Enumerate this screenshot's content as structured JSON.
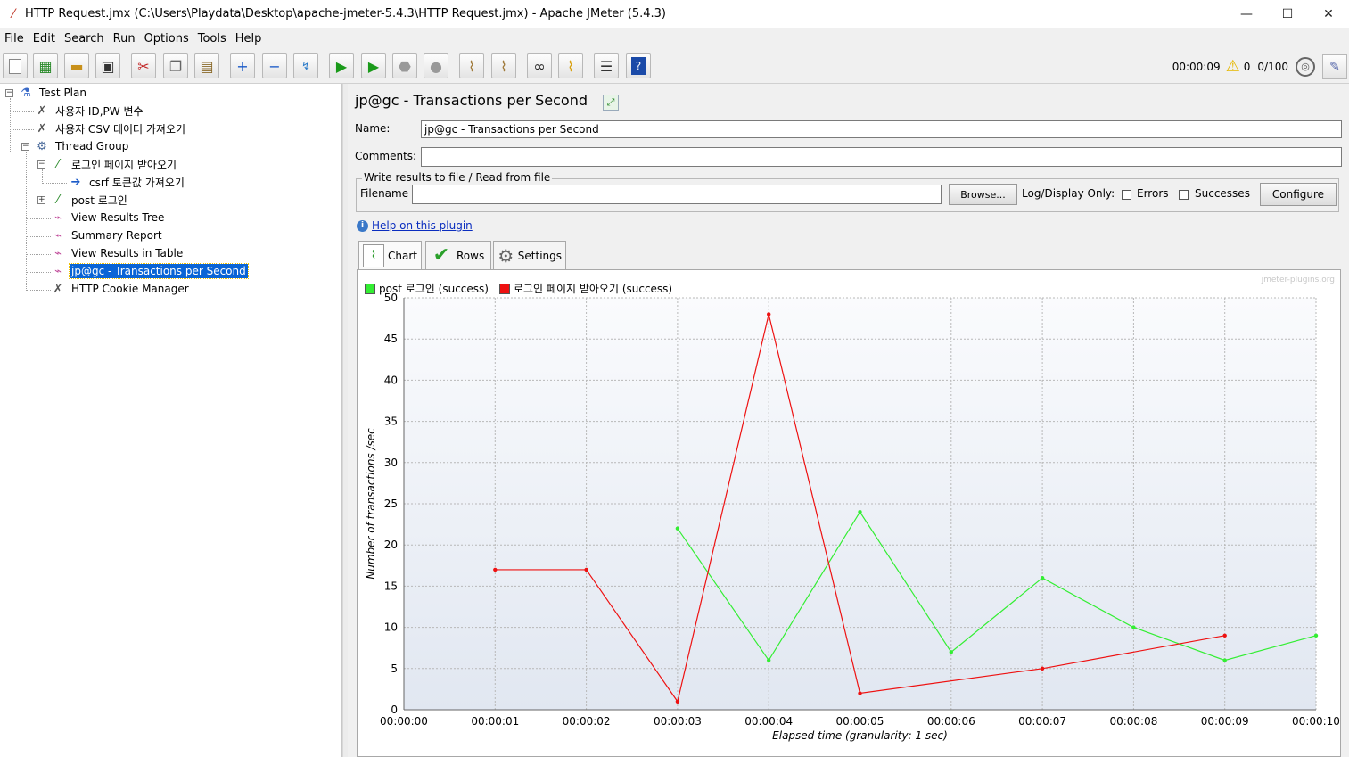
{
  "window": {
    "title": "HTTP Request.jmx (C:\\Users\\Playdata\\Desktop\\apache-jmeter-5.4.3\\HTTP Request.jmx) - Apache JMeter (5.4.3)",
    "minimize": "—",
    "maximize": "☐",
    "close": "✕"
  },
  "menu": [
    "File",
    "Edit",
    "Search",
    "Run",
    "Options",
    "Tools",
    "Help"
  ],
  "toolbar": {
    "elapsed": "00:00:09",
    "warnings": "0",
    "threads": "0/100"
  },
  "tree": {
    "nodes": [
      {
        "label": "Test Plan",
        "icon": "flask-icon"
      },
      {
        "label": "사용자 ID,PW 변수",
        "icon": "wrench-icon"
      },
      {
        "label": "사용자 CSV 데이터 가져오기",
        "icon": "wrench-icon"
      },
      {
        "label": "Thread Group",
        "icon": "gear-icon"
      },
      {
        "label": "로그인 페이지 받아오기",
        "icon": "pipette-icon"
      },
      {
        "label": "csrf 토큰값 가져오기",
        "icon": "extractor-icon"
      },
      {
        "label": "post 로그인",
        "icon": "pipette-icon"
      },
      {
        "label": "View Results Tree",
        "icon": "graph-icon"
      },
      {
        "label": "Summary Report",
        "icon": "graph-icon"
      },
      {
        "label": "View Results in Table",
        "icon": "graph-icon"
      },
      {
        "label": "jp@gc - Transactions per Second",
        "icon": "graph-icon"
      },
      {
        "label": "HTTP Cookie Manager",
        "icon": "wrench-icon"
      }
    ]
  },
  "panel": {
    "title": "jp@gc - Transactions per Second",
    "name_label": "Name:",
    "name_value": "jp@gc - Transactions per Second",
    "comments_label": "Comments:",
    "comments_value": "",
    "file_group_legend": "Write results to file / Read from file",
    "filename_label": "Filename",
    "filename_value": "",
    "browse_label": "Browse...",
    "log_display_label": "Log/Display Only:",
    "errors_label": "Errors",
    "successes_label": "Successes",
    "configure_label": "Configure",
    "help_link": "Help on this plugin",
    "tabs": [
      {
        "label": "Chart",
        "icon": "chart-icon"
      },
      {
        "label": "Rows",
        "icon": "checkmark-icon"
      },
      {
        "label": "Settings",
        "icon": "gear-icon"
      }
    ],
    "watermark": "jmeter-plugins.org"
  },
  "chart_data": {
    "type": "line",
    "xlabel": "Elapsed time (granularity: 1 sec)",
    "ylabel": "Number of transactions /sec",
    "ylim": [
      0,
      50
    ],
    "yticks": [
      0,
      5,
      10,
      15,
      20,
      25,
      30,
      35,
      40,
      45,
      50
    ],
    "xticks": [
      "00:00:00",
      "00:00:01",
      "00:00:02",
      "00:00:03",
      "00:00:04",
      "00:00:05",
      "00:00:06",
      "00:00:07",
      "00:00:08",
      "00:00:09",
      "00:00:10"
    ],
    "grid": true,
    "legend_position": "top-left",
    "series": [
      {
        "name": "post 로그인 (success)",
        "color": "#33ee33",
        "points": [
          [
            3,
            22
          ],
          [
            4,
            6
          ],
          [
            5,
            24
          ],
          [
            6,
            7
          ],
          [
            7,
            16
          ],
          [
            8,
            10
          ],
          [
            9,
            6
          ],
          [
            10,
            9
          ]
        ]
      },
      {
        "name": "로그인 페이지 받아오기 (success)",
        "color": "#ee1111",
        "points": [
          [
            1,
            17
          ],
          [
            2,
            17
          ],
          [
            3,
            1
          ],
          [
            4,
            48
          ],
          [
            5,
            2
          ],
          [
            7,
            5
          ],
          [
            9,
            9
          ]
        ]
      }
    ]
  }
}
